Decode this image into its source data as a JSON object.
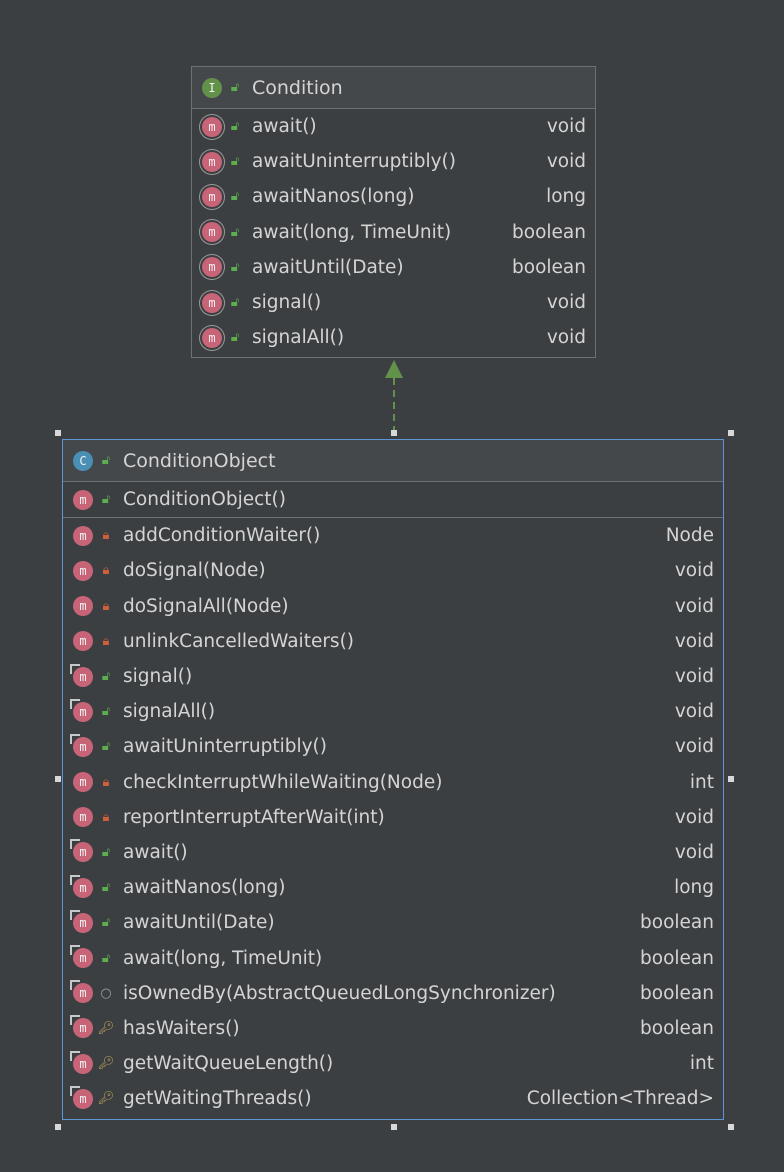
{
  "interface": {
    "kind": "I",
    "name": "Condition",
    "methods": [
      {
        "name": "await()",
        "ret": "void"
      },
      {
        "name": "awaitUninterruptibly()",
        "ret": "void"
      },
      {
        "name": "awaitNanos(long)",
        "ret": "long"
      },
      {
        "name": "await(long, TimeUnit)",
        "ret": "boolean"
      },
      {
        "name": "awaitUntil(Date)",
        "ret": "boolean"
      },
      {
        "name": "signal()",
        "ret": "void"
      },
      {
        "name": "signalAll()",
        "ret": "void"
      }
    ]
  },
  "class": {
    "kind": "C",
    "name": "ConditionObject",
    "constructor": {
      "name": "ConditionObject()",
      "vis": "public"
    },
    "methods": [
      {
        "name": "addConditionWaiter()",
        "ret": "Node",
        "vis": "private",
        "override": false
      },
      {
        "name": "doSignal(Node)",
        "ret": "void",
        "vis": "private",
        "override": false
      },
      {
        "name": "doSignalAll(Node)",
        "ret": "void",
        "vis": "private",
        "override": false
      },
      {
        "name": "unlinkCancelledWaiters()",
        "ret": "void",
        "vis": "private",
        "override": false
      },
      {
        "name": "signal()",
        "ret": "void",
        "vis": "public",
        "override": true
      },
      {
        "name": "signalAll()",
        "ret": "void",
        "vis": "public",
        "override": true
      },
      {
        "name": "awaitUninterruptibly()",
        "ret": "void",
        "vis": "public",
        "override": true
      },
      {
        "name": "checkInterruptWhileWaiting(Node)",
        "ret": "int",
        "vis": "private",
        "override": false
      },
      {
        "name": "reportInterruptAfterWait(int)",
        "ret": "void",
        "vis": "private",
        "override": false
      },
      {
        "name": "await()",
        "ret": "void",
        "vis": "public",
        "override": true
      },
      {
        "name": "awaitNanos(long)",
        "ret": "long",
        "vis": "public",
        "override": true
      },
      {
        "name": "awaitUntil(Date)",
        "ret": "boolean",
        "vis": "public",
        "override": true
      },
      {
        "name": "await(long, TimeUnit)",
        "ret": "boolean",
        "vis": "public",
        "override": true
      },
      {
        "name": "isOwnedBy(AbstractQueuedLongSynchronizer)",
        "ret": "boolean",
        "vis": "package",
        "override": true
      },
      {
        "name": "hasWaiters()",
        "ret": "boolean",
        "vis": "protected",
        "override": true
      },
      {
        "name": "getWaitQueueLength()",
        "ret": "int",
        "vis": "protected",
        "override": true
      },
      {
        "name": "getWaitingThreads()",
        "ret": "Collection<Thread>",
        "vis": "protected",
        "override": true
      }
    ]
  },
  "relation": {
    "type": "implements",
    "style": "dashed",
    "color": "#62924a"
  },
  "colors": {
    "background": "#3c3f41",
    "selection": "#5e95d9"
  }
}
